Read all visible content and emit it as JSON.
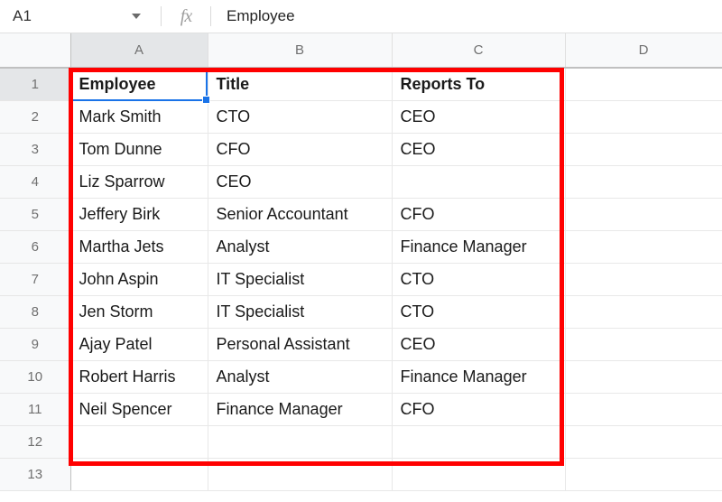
{
  "formula_bar": {
    "name_box_value": "A1",
    "name_box_caret_icon": "chevron-down-icon",
    "fx_icon": "fx-icon",
    "fx_label": "fx",
    "formula_value": "Employee"
  },
  "grid": {
    "column_headers": [
      "A",
      "B",
      "C",
      "D"
    ],
    "active_column": "A",
    "active_row": "1",
    "row_numbers": [
      "1",
      "2",
      "3",
      "4",
      "5",
      "6",
      "7",
      "8",
      "9",
      "10",
      "11",
      "12",
      "13"
    ],
    "rows": [
      {
        "num": "1",
        "header": true,
        "a": "Employee",
        "b": "Title",
        "c": "Reports To",
        "d": ""
      },
      {
        "num": "2",
        "header": false,
        "a": "Mark Smith",
        "b": "CTO",
        "c": "CEO",
        "d": ""
      },
      {
        "num": "3",
        "header": false,
        "a": "Tom Dunne",
        "b": "CFO",
        "c": "CEO",
        "d": ""
      },
      {
        "num": "4",
        "header": false,
        "a": "Liz Sparrow",
        "b": "CEO",
        "c": "",
        "d": ""
      },
      {
        "num": "5",
        "header": false,
        "a": "Jeffery Birk",
        "b": "Senior Accountant",
        "c": "CFO",
        "d": ""
      },
      {
        "num": "6",
        "header": false,
        "a": "Martha Jets",
        "b": "Analyst",
        "c": "Finance Manager",
        "d": ""
      },
      {
        "num": "7",
        "header": false,
        "a": "John Aspin",
        "b": "IT Specialist",
        "c": "CTO",
        "d": ""
      },
      {
        "num": "8",
        "header": false,
        "a": "Jen Storm",
        "b": "IT Specialist",
        "c": "CTO",
        "d": ""
      },
      {
        "num": "9",
        "header": false,
        "a": "Ajay Patel",
        "b": "Personal Assistant",
        "c": "CEO",
        "d": ""
      },
      {
        "num": "10",
        "header": false,
        "a": "Robert Harris",
        "b": "Analyst",
        "c": "Finance Manager",
        "d": ""
      },
      {
        "num": "11",
        "header": false,
        "a": "Neil Spencer",
        "b": "Finance Manager",
        "c": "CFO",
        "d": ""
      },
      {
        "num": "12",
        "header": false,
        "a": "",
        "b": "",
        "c": "",
        "d": ""
      },
      {
        "num": "13",
        "header": false,
        "a": "",
        "b": "",
        "c": "",
        "d": ""
      }
    ]
  },
  "annotation": {
    "color": "#ff0000",
    "shape": "rectangle-outline"
  },
  "colors": {
    "selection_border": "#1a73e8",
    "header_background": "#f8f9fa",
    "active_header_background": "#e4e6e8",
    "grid_line": "#e8e8e8",
    "text": "#1a1a1a"
  }
}
